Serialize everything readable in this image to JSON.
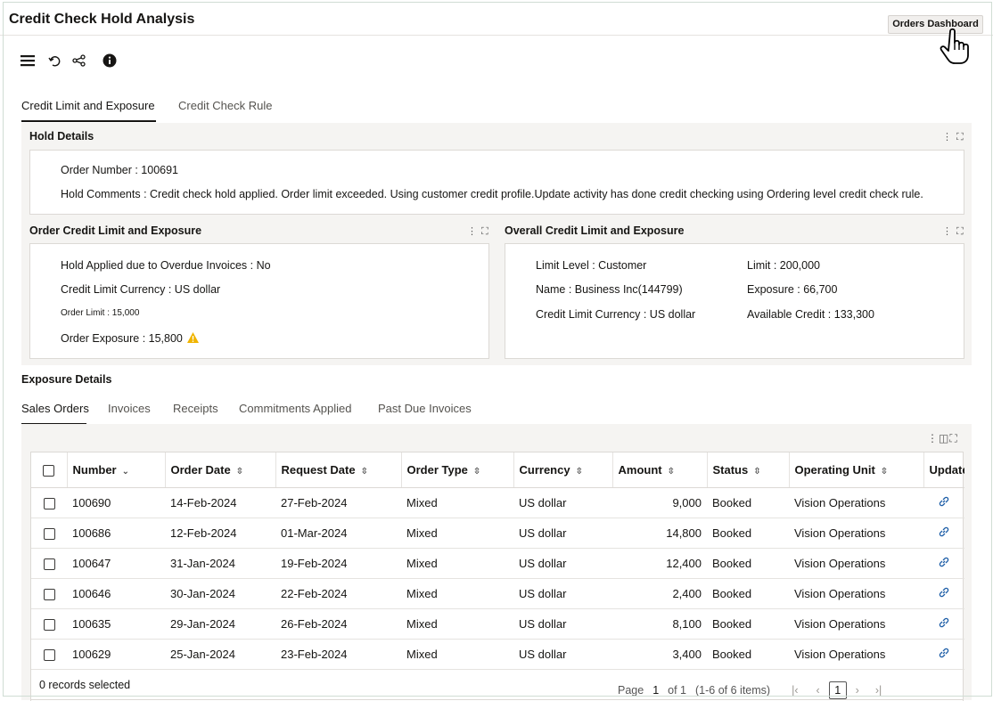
{
  "app": {
    "title": "Credit Check Hold Analysis",
    "dashboard_button": "Orders Dashboard"
  },
  "toolbar": {
    "icons": [
      "hamburger-menu-icon",
      "undo-icon",
      "share-icon",
      "info-icon"
    ]
  },
  "main_tabs": [
    {
      "label": "Credit Limit and Exposure",
      "active": true
    },
    {
      "label": "Credit Check Rule",
      "active": false
    }
  ],
  "hold_details": {
    "title": "Hold Details",
    "order_number": "Order Number : 100691",
    "hold_comments": "Hold Comments : Credit check hold applied. Order limit exceeded. Using customer credit profile.Update activity has done credit checking using Ordering level credit check rule."
  },
  "order_credit": {
    "title": "Order Credit Limit and Exposure",
    "hold_overdue": "Hold Applied due to Overdue Invoices : No",
    "currency": "Credit Limit Currency : US dollar",
    "order_limit": "Order Limit : 15,000",
    "order_exposure": "Order Exposure : 15,800",
    "warning_color": "#f0b400"
  },
  "overall_credit": {
    "title": "Overall Credit Limit and Exposure",
    "limit_level": "Limit Level : Customer",
    "name": "Name : Business Inc(144799)",
    "currency": "Credit Limit Currency : US dollar",
    "limit": "Limit : 200,000",
    "exposure": "Exposure : 66,700",
    "available": "Available Credit : 133,300"
  },
  "exposure_details": {
    "title": "Exposure Details",
    "tabs": [
      {
        "label": "Sales Orders",
        "active": true
      },
      {
        "label": "Invoices",
        "active": false
      },
      {
        "label": "Receipts",
        "active": false
      },
      {
        "label": "Commitments Applied",
        "active": false
      },
      {
        "label": "Past Due Invoices",
        "active": false
      }
    ]
  },
  "table": {
    "columns": [
      "Number",
      "Order Date",
      "Request Date",
      "Order Type",
      "Currency",
      "Amount",
      "Status",
      "Operating Unit",
      "Update"
    ],
    "rows": [
      [
        "100690",
        "14-Feb-2024",
        "27-Feb-2024",
        "Mixed",
        "US dollar",
        "9,000",
        "Booked",
        "Vision Operations"
      ],
      [
        "100686",
        "12-Feb-2024",
        "01-Mar-2024",
        "Mixed",
        "US dollar",
        "14,800",
        "Booked",
        "Vision Operations"
      ],
      [
        "100647",
        "31-Jan-2024",
        "19-Feb-2024",
        "Mixed",
        "US dollar",
        "12,400",
        "Booked",
        "Vision Operations"
      ],
      [
        "100646",
        "30-Jan-2024",
        "22-Feb-2024",
        "Mixed",
        "US dollar",
        "2,400",
        "Booked",
        "Vision Operations"
      ],
      [
        "100635",
        "29-Jan-2024",
        "26-Feb-2024",
        "Mixed",
        "US dollar",
        "8,100",
        "Booked",
        "Vision Operations"
      ],
      [
        "100629",
        "25-Jan-2024",
        "23-Feb-2024",
        "Mixed",
        "US dollar",
        "3,400",
        "Booked",
        "Vision Operations"
      ]
    ],
    "records_selected": "0 records selected",
    "pager": {
      "page_label": "Page",
      "page_num": "1",
      "of_label": "of 1",
      "range": "(1-6 of 6 items)",
      "current": "1"
    }
  }
}
